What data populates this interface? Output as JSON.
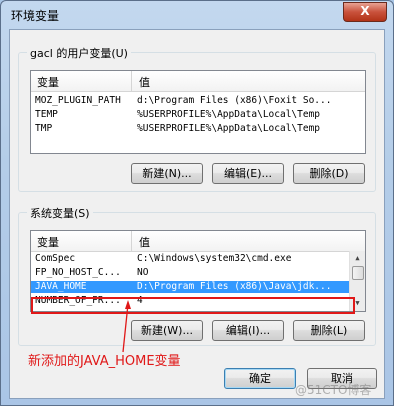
{
  "window": {
    "title": "环境变量",
    "close_glyph": "X"
  },
  "user_vars": {
    "group_label": "gacl 的用户变量(U)",
    "col_var": "变量",
    "col_val": "值",
    "rows": [
      {
        "name": "MOZ_PLUGIN_PATH",
        "value": "d:\\Program Files (x86)\\Foxit So..."
      },
      {
        "name": "TEMP",
        "value": "%USERPROFILE%\\AppData\\Local\\Temp"
      },
      {
        "name": "TMP",
        "value": "%USERPROFILE%\\AppData\\Local\\Temp"
      }
    ],
    "buttons": {
      "new": "新建(N)...",
      "edit": "编辑(E)...",
      "delete": "删除(D)"
    }
  },
  "system_vars": {
    "group_label": "系统变量(S)",
    "col_var": "变量",
    "col_val": "值",
    "rows": [
      {
        "name": "ComSpec",
        "value": "C:\\Windows\\system32\\cmd.exe"
      },
      {
        "name": "FP_NO_HOST_C...",
        "value": "NO"
      },
      {
        "name": "JAVA_HOME",
        "value": "D:\\Program Files (x86)\\Java\\jdk..."
      },
      {
        "name": "NUMBER_OF_PR...",
        "value": "4"
      }
    ],
    "selected_index": 2,
    "buttons": {
      "new": "新建(W)...",
      "edit": "编辑(I)...",
      "delete": "删除(L)"
    }
  },
  "annotation": {
    "text": "新添加的JAVA_HOME变量",
    "color": "#e01818"
  },
  "footer": {
    "ok": "确定",
    "cancel": "取消"
  },
  "watermark": "@51CTO博客"
}
